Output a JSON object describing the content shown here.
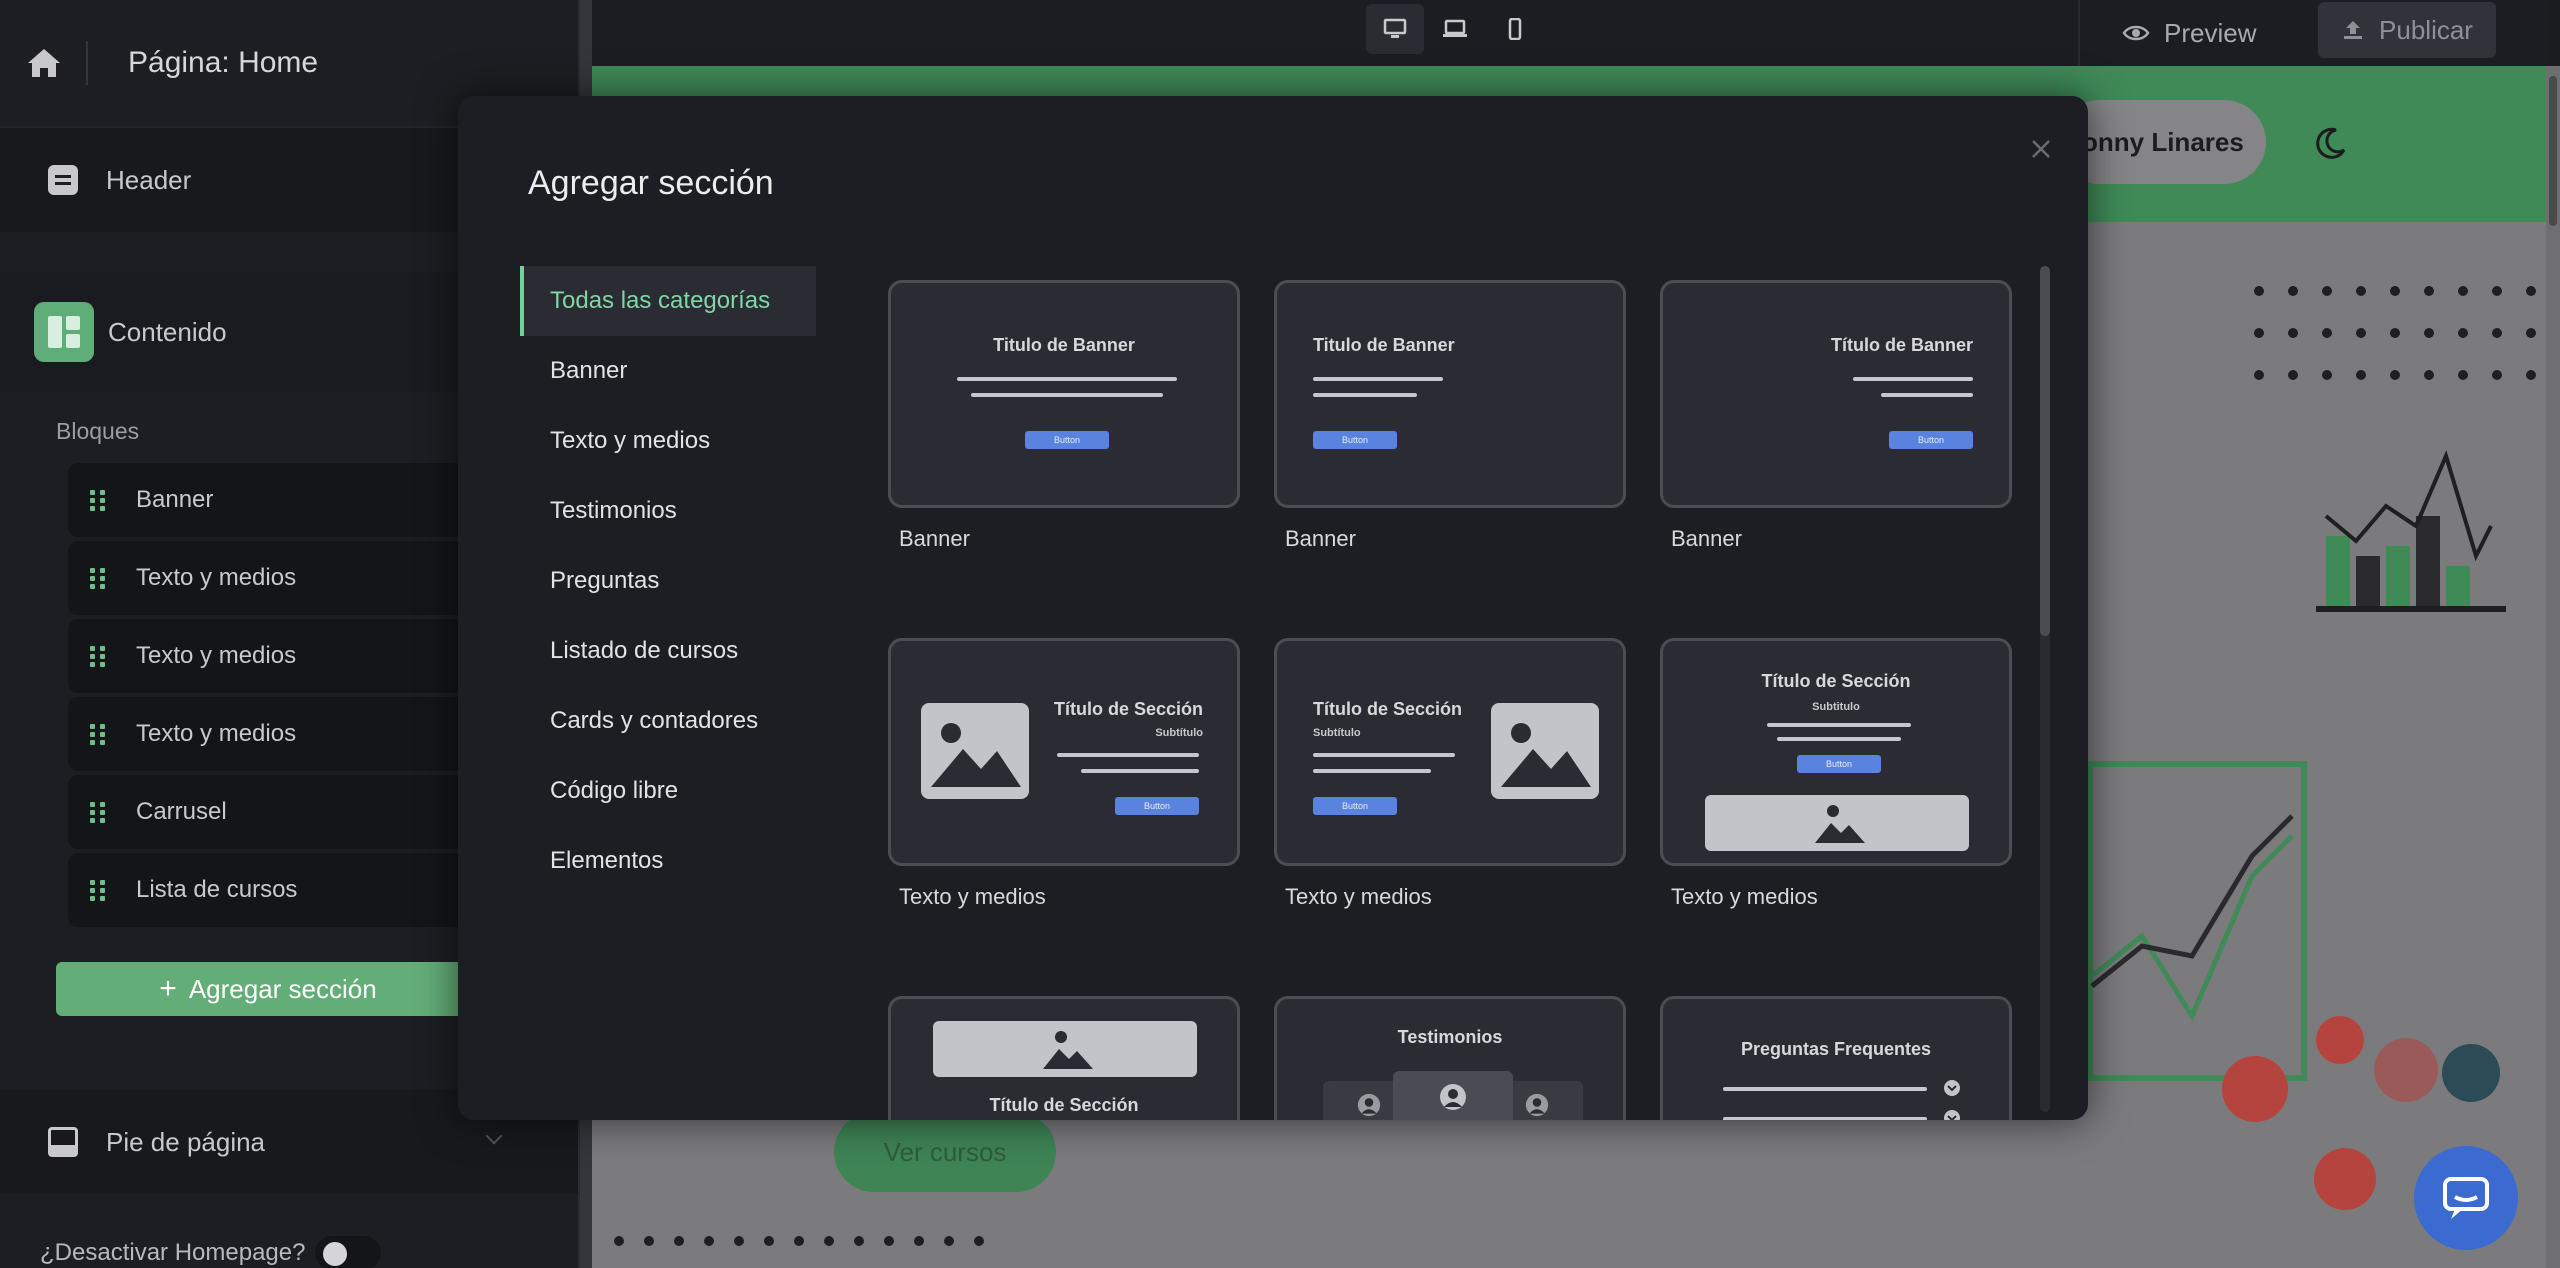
{
  "sidebar": {
    "page_title": "Página: Home",
    "header_label": "Header",
    "content_label": "Contenido",
    "blocks_heading": "Bloques",
    "blocks": [
      {
        "label": "Banner"
      },
      {
        "label": "Texto y medios"
      },
      {
        "label": "Texto y medios"
      },
      {
        "label": "Texto y medios"
      },
      {
        "label": "Carrusel"
      },
      {
        "label": "Lista de cursos"
      }
    ],
    "add_section_label": "Agregar sección",
    "footer_label": "Pie de página",
    "deactivate_homepage_label": "¿Desactivar Homepage?"
  },
  "toolbar": {
    "preview_label": "Preview",
    "publish_label": "Publicar",
    "devices": [
      "desktop-icon",
      "laptop-icon",
      "mobile-icon"
    ],
    "active_device": "desktop"
  },
  "preview": {
    "user_name": "onny Linares",
    "cta_label": "Ver cursos"
  },
  "modal": {
    "title": "Agregar sección",
    "categories": [
      {
        "label": "Todas las categorías",
        "active": true
      },
      {
        "label": "Banner"
      },
      {
        "label": "Texto y medios"
      },
      {
        "label": "Testimonios"
      },
      {
        "label": "Preguntas"
      },
      {
        "label": "Listado de cursos"
      },
      {
        "label": "Cards y contadores"
      },
      {
        "label": "Código libre"
      },
      {
        "label": "Elementos"
      }
    ],
    "tiles": [
      {
        "label": "Banner",
        "title": "Titulo de Banner",
        "button": "Button"
      },
      {
        "label": "Banner",
        "title": "Titulo de Banner",
        "button": "Button"
      },
      {
        "label": "Banner",
        "title": "Título de Banner",
        "button": "Button"
      },
      {
        "label": "Texto y medios",
        "title": "Título de Sección",
        "subtitle": "Subtítulo",
        "button": "Button"
      },
      {
        "label": "Texto y medios",
        "title": "Título de Sección",
        "subtitle": "Subtítulo",
        "button": "Button"
      },
      {
        "label": "Texto y medios",
        "title": "Título de Sección",
        "subtitle": "Subtitulo",
        "button": "Button"
      },
      {
        "title": "Título de Sección"
      },
      {
        "title": "Testimonios"
      },
      {
        "title": "Preguntas Frequentes"
      }
    ]
  },
  "colors": {
    "accent_green": "#63ad78",
    "active_category": "#7ed7a4",
    "button_blue": "#5a83e0",
    "chat_blue": "#3b6ad0"
  }
}
